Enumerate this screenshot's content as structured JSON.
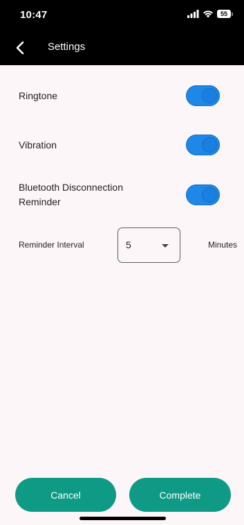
{
  "status_bar": {
    "time": "10:47",
    "battery": "55",
    "signal_icon": "signal-bars-icon",
    "wifi_icon": "wifi-icon"
  },
  "header": {
    "back_icon": "chevron-left-icon",
    "title": "Settings"
  },
  "settings": [
    {
      "label": "Ringtone",
      "enabled": true
    },
    {
      "label": "Vibration",
      "enabled": true
    },
    {
      "label": "Bluetooth Disconnection Reminder",
      "enabled": true
    }
  ],
  "reminder": {
    "label": "Reminder Interval",
    "value": "5",
    "unit": "Minutes"
  },
  "buttons": {
    "cancel": "Cancel",
    "complete": "Complete"
  },
  "colors": {
    "header_bg": "#000000",
    "page_bg": "#fdf6f8",
    "switch_on": "#1e87e8",
    "button_bg": "#0e9a85"
  }
}
